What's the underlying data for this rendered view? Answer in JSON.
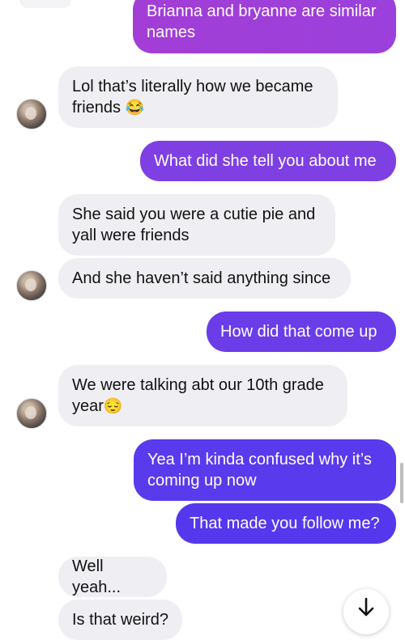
{
  "messages": [
    {
      "id": "m1",
      "side": "out",
      "text": "Brianna and bryanne are similar names",
      "color": "#a23ed6"
    },
    {
      "id": "m2",
      "side": "in",
      "text": "Lol that’s literally how we became friends",
      "emoji": "😂"
    },
    {
      "id": "m3",
      "side": "out",
      "text": "What did she tell you about me",
      "color": "#7e3fe3"
    },
    {
      "id": "m4",
      "side": "in",
      "text": "She said you were a cutie pie and yall were friends"
    },
    {
      "id": "m5",
      "side": "in",
      "text": "And she haven’t said anything since"
    },
    {
      "id": "m6",
      "side": "out",
      "text": "How did that come up",
      "color": "#6a3de9"
    },
    {
      "id": "m7",
      "side": "in",
      "text": "We were talking abt our 10th grade year",
      "emoji": "😔"
    },
    {
      "id": "m8",
      "side": "out",
      "text": "Yea I’m kinda confused why it’s coming up now",
      "color": "#5a3aed"
    },
    {
      "id": "m9",
      "side": "out",
      "text": "That made you follow me?",
      "color": "#5538ee"
    },
    {
      "id": "m10",
      "side": "in",
      "text": "Well yeah..."
    },
    {
      "id": "m11",
      "side": "in",
      "text": "Is that weird?"
    }
  ],
  "controls": {
    "scroll_down_icon": "arrow-down-icon"
  }
}
